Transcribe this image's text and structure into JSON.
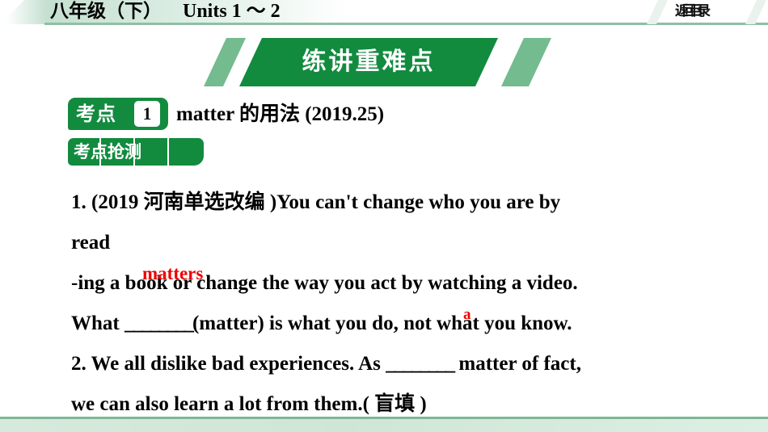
{
  "header": {
    "title_cn": "八年级（下）",
    "title_en": "Units 1 ～ 2",
    "return_label": "返回目录"
  },
  "banner": {
    "title": "练讲重难点"
  },
  "point": {
    "badge_label": "考点",
    "number": "1",
    "title": "matter 的用法 (2019.25)",
    "quiz_badge_label": "考点抢测"
  },
  "questions": {
    "line1": "1. (2019 河南单选改编 )You can't change who you are by",
    "line2": "read",
    "line3": "-ing a book or change the way you act by watching a video.",
    "line4_a": "What ",
    "line4_blank": "________",
    "line4_b": "(matter) is what you do, not what you know.",
    "line5_a": "2. We all dislike bad experiences. As ",
    "line5_blank": "________",
    "line5_b": " matter of fact,",
    "line6": "we can also learn a lot from them.( 盲填 )"
  },
  "annotations": {
    "answer1": "matters",
    "answer2": "a",
    "color": "#ee0000"
  },
  "colors": {
    "banner_green": "#128b3f",
    "banner_light_green": "#74bb8f",
    "header_tint": "#dceee4",
    "footer_green": "#7fb795"
  }
}
